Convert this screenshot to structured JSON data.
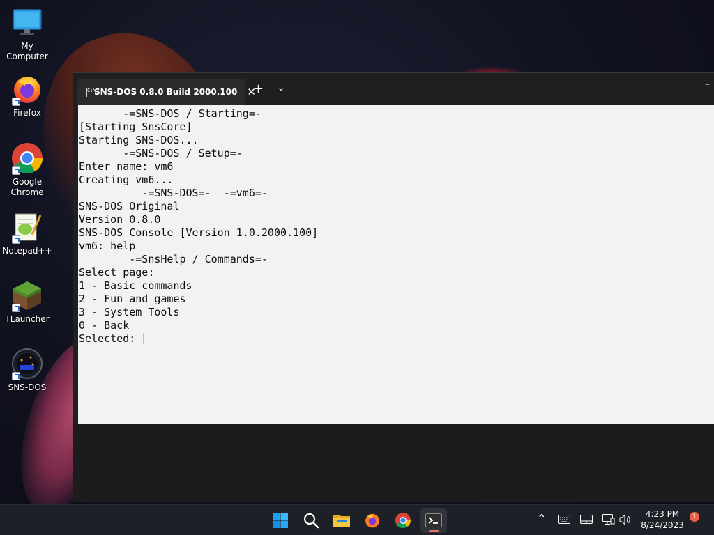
{
  "desktop": {
    "icons": [
      {
        "label": "My Computer",
        "icon": "monitor-icon"
      },
      {
        "label": "Firefox",
        "icon": "firefox-icon"
      },
      {
        "label": "Google Chrome",
        "icon": "chrome-icon"
      },
      {
        "label": "Notepad++",
        "icon": "notepad-plus-plus-icon"
      },
      {
        "label": "TLauncher",
        "icon": "grass-block-icon"
      },
      {
        "label": "SNS-DOS",
        "icon": "sns-dos-icon"
      }
    ]
  },
  "terminal": {
    "tab_title": "SNS-DOS 0.8.0 Build 2000.100",
    "new_tab_label": "+",
    "close_label": "✕",
    "dropdown_label": "⌄",
    "minimize_label": "–",
    "lines": [
      "       -=SNS-DOS / Starting=-",
      "[Starting SnsCore]",
      "Starting SNS-DOS...",
      "       -=SNS-DOS / Setup=-",
      "Enter name: vm6",
      "Creating vm6...",
      "          -=SNS-DOS=-  -=vm6=-",
      "SNS-DOS Original",
      "Version 0.8.0",
      "SNS-DOS Console [Version 1.0.2000.100]",
      "vm6: help",
      "        -=SnsHelp / Commands=-",
      "Select page:",
      "1 - Basic commands",
      "2 - Fun and games",
      "3 - System Tools",
      "0 - Back",
      "Selected: "
    ]
  },
  "taskbar": {
    "apps": [
      "start-icon",
      "search-icon",
      "file-explorer-icon",
      "firefox-icon",
      "chrome-icon",
      "terminal-icon"
    ],
    "clock_time": "4:23 PM",
    "clock_date": "8/24/2023",
    "notification_count": "1"
  },
  "colors": {
    "console_bg": "#f2f2f2",
    "console_fg": "#0c0c0c",
    "titlebar_bg": "#1f1f1f",
    "taskbar_bg": "#1e2028",
    "accent": "#0078d4"
  }
}
